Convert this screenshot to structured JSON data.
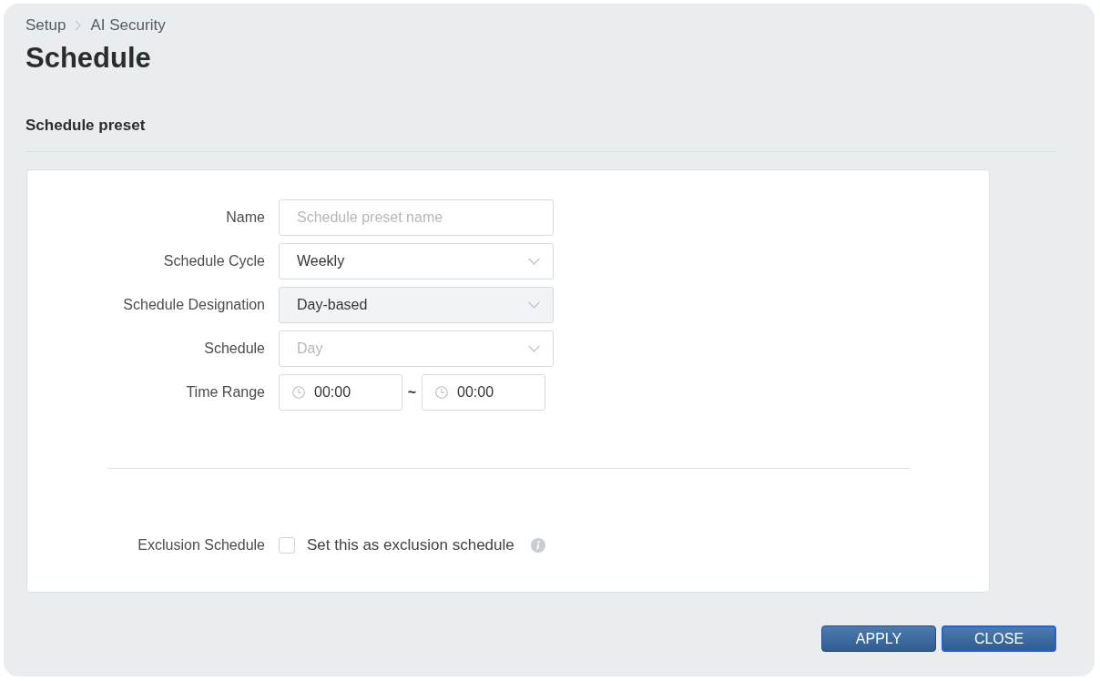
{
  "breadcrumb": [
    {
      "label": "Setup"
    },
    {
      "label": "AI Security"
    }
  ],
  "title": "Schedule",
  "section": {
    "title": "Schedule preset"
  },
  "form": {
    "fields": [
      {
        "kind": "text",
        "label": "Name",
        "placeholder": "Schedule preset name"
      },
      {
        "kind": "select",
        "label": "Schedule Cycle",
        "value": "Weekly",
        "hovered": false
      },
      {
        "kind": "select",
        "label": "Schedule Designation",
        "value": "Day-based",
        "hovered": true
      },
      {
        "kind": "select",
        "label": "Schedule",
        "placeholder": "Day",
        "hovered": false
      },
      {
        "kind": "time_range",
        "label": "Time Range",
        "start": "00:00",
        "separator": "~",
        "end": "00:00"
      }
    ],
    "exclusion": {
      "label": "Exclusion Schedule",
      "checkbox_label": "Set this as exclusion schedule",
      "checked": false
    }
  },
  "buttons": [
    {
      "label": "APPLY",
      "focused": false
    },
    {
      "label": "CLOSE",
      "focused": true
    }
  ]
}
